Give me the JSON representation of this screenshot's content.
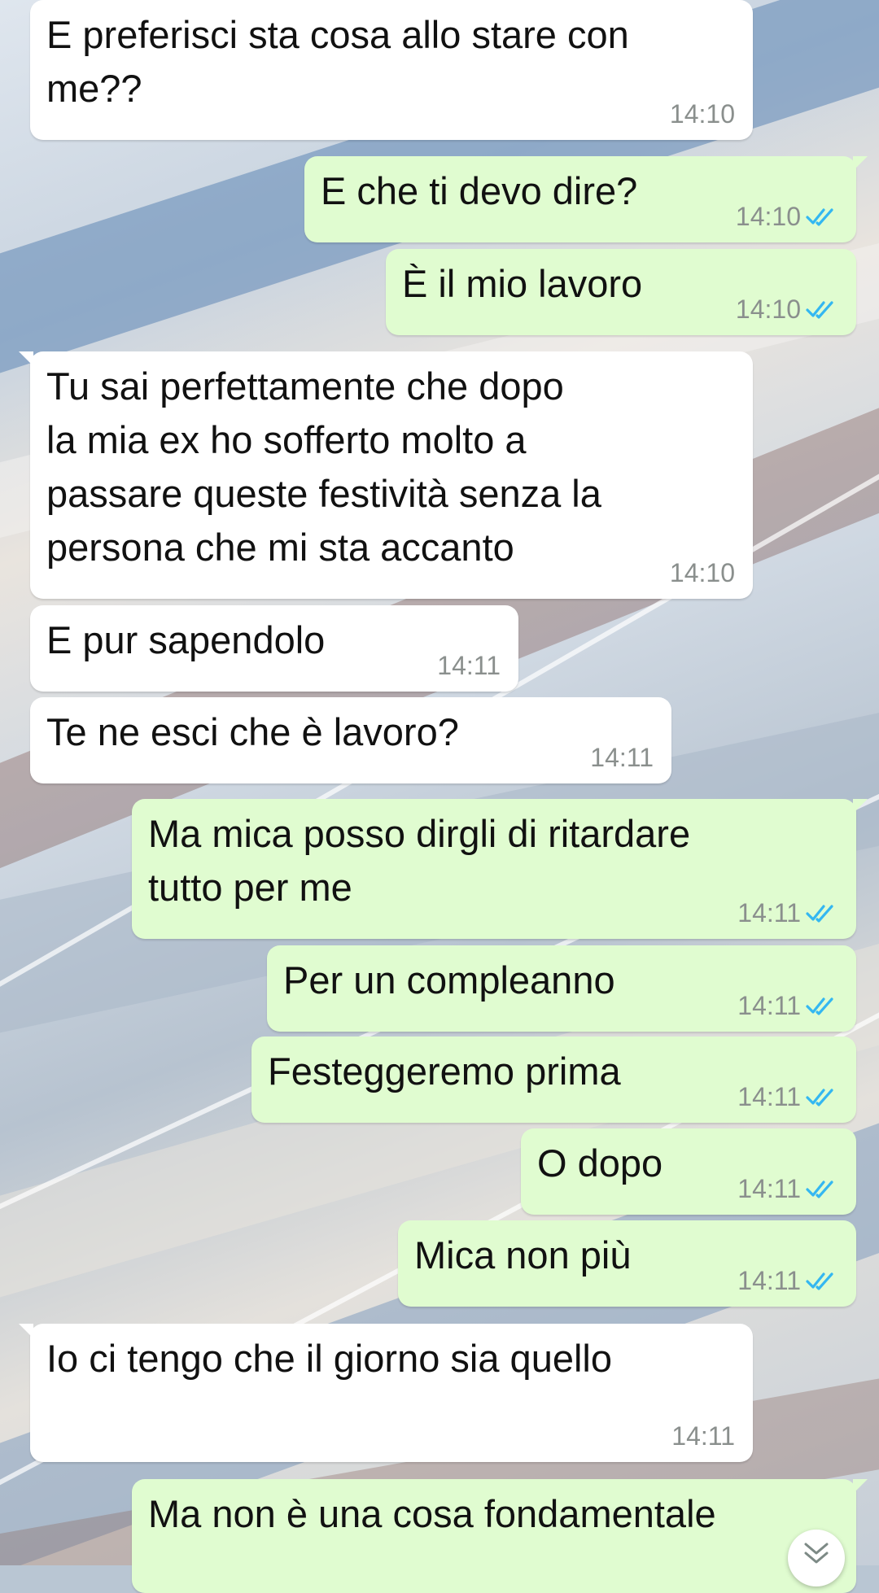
{
  "colors": {
    "incoming_bubble": "#ffffff",
    "outgoing_bubble": "#e0fcd0",
    "timestamp": "#8a8f8d",
    "read_ticks": "#34b7f1"
  },
  "messages": [
    {
      "direction": "incoming",
      "text": "E preferisci sta cosa allo stare con\nme??",
      "time": "14:10"
    },
    {
      "direction": "outgoing",
      "text": "E che ti devo dire?",
      "time": "14:10",
      "status": "read"
    },
    {
      "direction": "outgoing",
      "text": "È il mio lavoro",
      "time": "14:10",
      "status": "read"
    },
    {
      "direction": "incoming",
      "text": "Tu sai perfettamente che dopo\nla mia ex ho sofferto molto a\npassare queste festività senza la\npersona che mi sta accanto",
      "time": "14:10"
    },
    {
      "direction": "incoming",
      "text": "E pur sapendolo",
      "time": "14:11"
    },
    {
      "direction": "incoming",
      "text": "Te ne esci che è lavoro?",
      "time": "14:11"
    },
    {
      "direction": "outgoing",
      "text": "Ma mica posso dirgli di ritardare\ntutto per me",
      "time": "14:11",
      "status": "read"
    },
    {
      "direction": "outgoing",
      "text": "Per un compleanno",
      "time": "14:11",
      "status": "read"
    },
    {
      "direction": "outgoing",
      "text": "Festeggeremo prima",
      "time": "14:11",
      "status": "read"
    },
    {
      "direction": "outgoing",
      "text": "O dopo",
      "time": "14:11",
      "status": "read"
    },
    {
      "direction": "outgoing",
      "text": "Mica non più",
      "time": "14:11",
      "status": "read"
    },
    {
      "direction": "incoming",
      "text": "Io ci tengo che il giorno sia quello",
      "time": "14:11"
    },
    {
      "direction": "outgoing",
      "text": "Ma non è una cosa fondamentale",
      "time": "",
      "status": "read"
    }
  ],
  "scroll_button": {
    "icon": "double-chevron-down-icon"
  }
}
